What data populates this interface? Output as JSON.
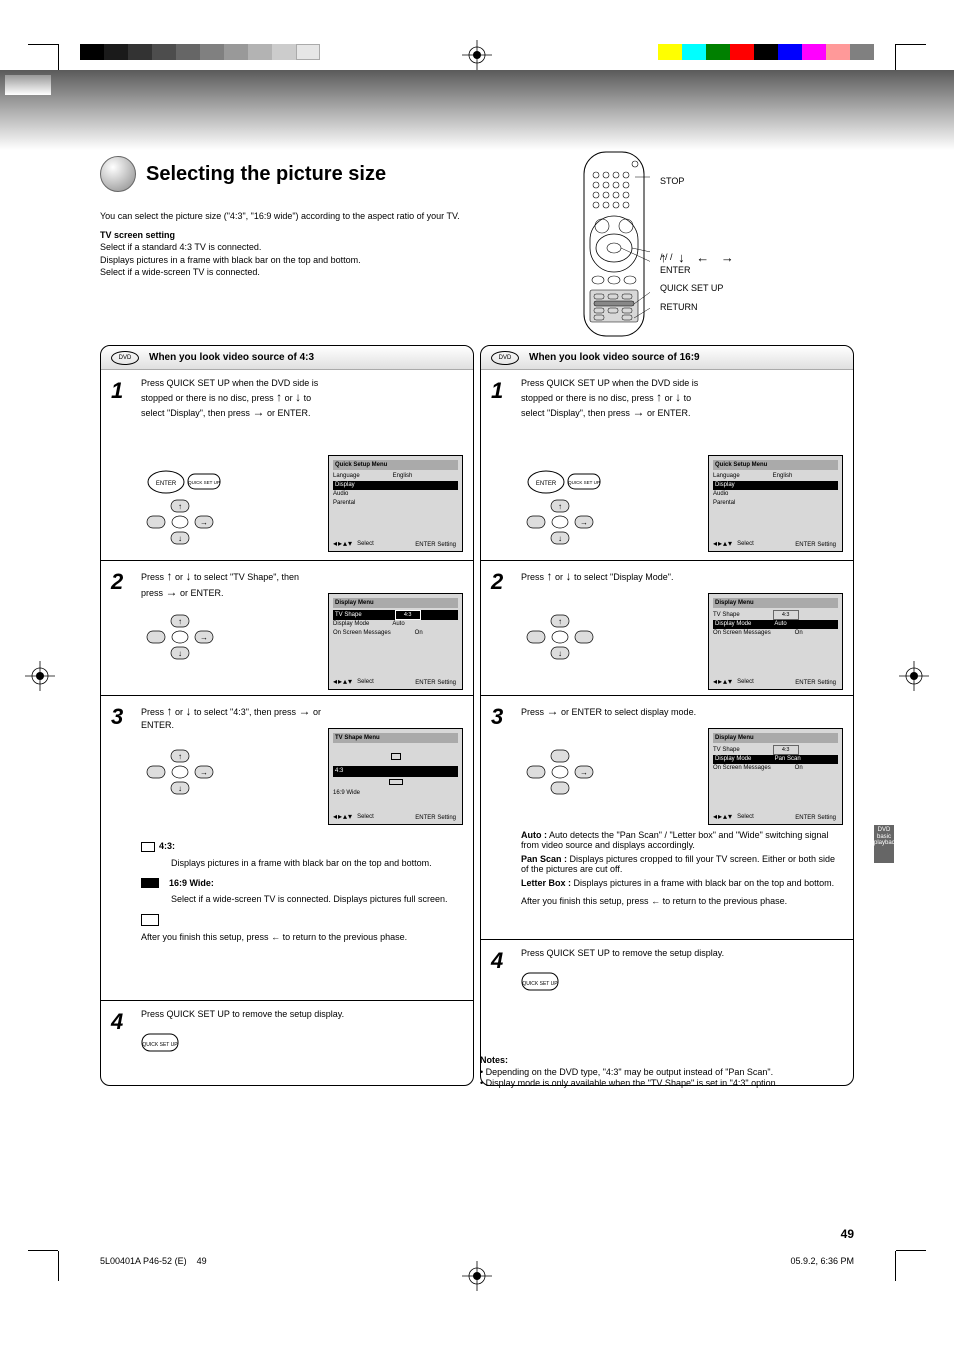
{
  "page_number": "49",
  "title": "Selecting the picture size",
  "intro": {
    "p1": "You can select the picture size (\"4:3\", \"16:9 wide\") according to the aspect ratio of your TV.",
    "subhead": "TV screen setting",
    "p2": "Select if a standard 4:3 TV is connected.\nDisplays pictures in a frame with black bar on the top and bottom.\nSelect if a wide-screen TV is connected."
  },
  "remote_labels": {
    "l1": "STOP",
    "l2": "/   /   /",
    "l3": "ENTER",
    "l4": "QUICK SET UP",
    "l5": "RETURN"
  },
  "left_panel": {
    "header": "When you look video source of 4:3",
    "badge": "DVD",
    "step1": {
      "text_a": "Press QUICK SET UP when the DVD side is stopped or there is no disc, press   or   to select \"Display\", then press   or ENTER.",
      "osd": {
        "title": "Quick Setup Menu",
        "rows": [
          {
            "label": "Language",
            "val": "English"
          },
          {
            "label": "Display",
            "sel": true
          },
          {
            "label": "Audio"
          },
          {
            "label": "Parental"
          }
        ],
        "footer_select": "Select",
        "footer_setting": "Setting",
        "footer_enter": "ENTER"
      }
    },
    "step2": {
      "text_a": "Press   or   to select \"TV Shape\", then press   or ENTER.",
      "osd": {
        "title": "Display Menu",
        "rows": [
          {
            "label": "TV Shape",
            "val": "4:3",
            "sel": true
          },
          {
            "label": "Display Mode",
            "val": "Auto"
          },
          {
            "label": "On Screen Messages",
            "val": "On"
          }
        ],
        "footer_select": "Select",
        "footer_setting": "Setting",
        "footer_enter": "ENTER"
      }
    },
    "step3": {
      "text_a": "Press   or   to select \"4:3\", then press   or ENTER.",
      "osd": {
        "title": "TV Shape Menu",
        "rows": [
          {
            "label": "4:3",
            "box": true,
            "sel": true
          },
          {
            "label": "16:9 Wide",
            "box": true
          }
        ],
        "footer_select": "Select",
        "footer_setting": "Setting",
        "footer_enter": "ENTER"
      },
      "note_label": "4:3:",
      "note_text": "Displays pictures in a frame with black bar on the top and bottom.",
      "wide_label": "16:9 Wide:",
      "wide_text": "Select if a wide-screen TV is connected. Displays pictures full screen.",
      "return_text": "After you finish this setup, press   to return to the previous phase."
    },
    "step4": {
      "text": "Press QUICK SET UP to remove the setup display."
    }
  },
  "right_panel": {
    "header": "When you look video source of 16:9",
    "badge": "DVD",
    "step1": {
      "text_a": "Press QUICK SET UP when the DVD side is stopped or there is no disc, press   or   to select \"Display\", then press   or ENTER.",
      "osd": {
        "title": "Quick Setup Menu",
        "rows": [
          {
            "label": "Language",
            "val": "English"
          },
          {
            "label": "Display",
            "sel": true
          },
          {
            "label": "Audio"
          },
          {
            "label": "Parental"
          }
        ],
        "footer_select": "Select",
        "footer_setting": "Setting",
        "footer_enter": "ENTER"
      }
    },
    "step2": {
      "text_a": "Press   or   to select \"Display Mode\".",
      "osd": {
        "title": "Display Menu",
        "rows": [
          {
            "label": "TV Shape",
            "val": "4:3"
          },
          {
            "label": "Display Mode",
            "val": "Auto",
            "sel": true
          },
          {
            "label": "On Screen Messages",
            "val": "On"
          }
        ],
        "footer_select": "Select",
        "footer_setting": "Setting",
        "footer_enter": "ENTER"
      }
    },
    "step3": {
      "text_a": "Press   or ENTER to select display mode.",
      "osd": {
        "title": "Display Menu",
        "rows": [
          {
            "label": "TV Shape",
            "val": "4:3"
          },
          {
            "label": "Display Mode",
            "val": "Pan Scan",
            "sel": true
          },
          {
            "label": "On Screen Messages",
            "val": "On"
          }
        ],
        "footer_select": "Select",
        "footer_setting": "Setting",
        "footer_enter": "ENTER"
      },
      "mode_auto": "Auto :",
      "mode_auto_text": "Auto detects the \"Pan Scan\" / \"Letter box\" and \"Wide\" switching signal from video source and displays accordingly.",
      "mode_pan": "Pan Scan :",
      "mode_pan_text": "Displays pictures cropped to fill your TV screen. Either or both side of the pictures are cut off.",
      "mode_letter": "Letter Box :",
      "mode_letter_text": "Displays pictures in a frame with black bar on the top and bottom.",
      "return_text": "After you finish this setup, press   to return to the previous phase."
    },
    "step4": {
      "text": "Press QUICK SET UP to remove the setup display."
    },
    "notes": {
      "head": "Notes:",
      "n1": "• Depending on the DVD type, \"4:3\" may be output instead of \"Pan Scan\".",
      "n2": "• Display mode is only available when the \"TV Shape\" is set in \"4:3\" option."
    }
  },
  "sidebar_tab": "DVD basic playback",
  "footer_file": "5L00401A P46-52 (E)",
  "footer_page": "49",
  "footer_meta": "05.9.2, 6:36 PM"
}
